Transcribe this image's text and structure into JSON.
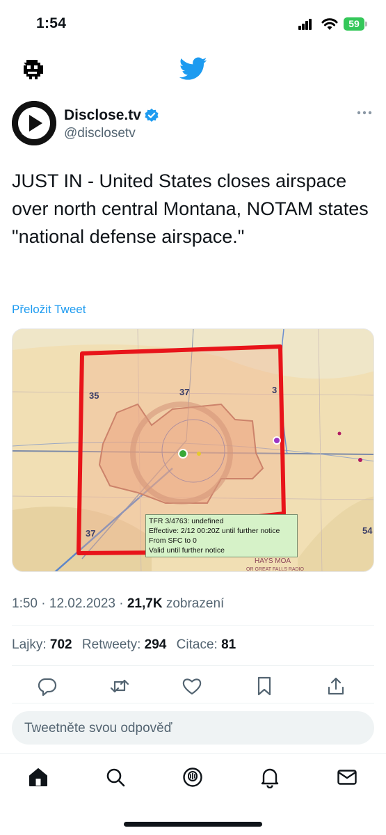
{
  "status_bar": {
    "time": "1:54",
    "battery": "59"
  },
  "author": {
    "name": "Disclose.tv",
    "handle": "@disclosetv"
  },
  "tweet": {
    "text": "JUST IN - United States closes airspace over north central Montana, NOTAM states \"national defense airspace.\"",
    "translate_label": "Přeložit Tweet"
  },
  "media": {
    "popup": {
      "line1": "TFR 3/4763: undefined",
      "line2": "Effective: 2/12 00:20Z until further notice",
      "line3": "From SFC to 0",
      "line4": "Valid until further notice"
    },
    "labels": {
      "area_nw": "35",
      "area_n": "37",
      "area_ne": "3",
      "area_sw": "37",
      "area_se": "54",
      "moa": "HAYS MOA",
      "moa_sub": "OR GREAT FALLS RADIO"
    },
    "colors": {
      "tfr_border": "#e8141a",
      "restricted_fill": "#e9a27c",
      "map_bg": "#f1dfb4"
    }
  },
  "meta": {
    "time": "1:50",
    "date": "12.02.2023",
    "views_count": "21,7K",
    "views_label": "zobrazení",
    "separator": "·"
  },
  "stats": {
    "likes_label": "Lajky:",
    "likes_count": "702",
    "retweets_label": "Retweety:",
    "retweets_count": "294",
    "quotes_label": "Citace:",
    "quotes_count": "81"
  },
  "actions": [
    "reply-icon",
    "retweet-icon",
    "like-icon",
    "bookmark-icon",
    "share-icon"
  ],
  "reply": {
    "placeholder": "Tweetněte svou odpověď"
  },
  "bottom_nav": [
    "home-icon",
    "search-icon",
    "spaces-icon",
    "notifications-icon",
    "messages-icon"
  ],
  "accent_color": "#1d9bf0"
}
